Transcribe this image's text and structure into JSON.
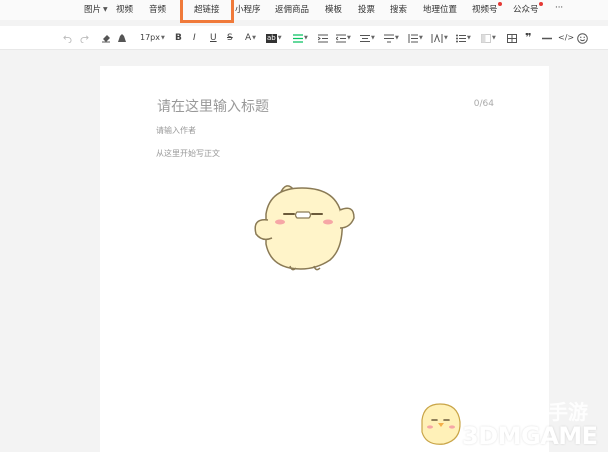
{
  "menu": {
    "items": [
      {
        "label": "图片",
        "dropdown": true
      },
      {
        "label": "视频"
      },
      {
        "label": "音频"
      },
      {
        "label": "超链接"
      },
      {
        "label": "小程序"
      },
      {
        "label": "返佣商品"
      },
      {
        "label": "模板"
      },
      {
        "label": "投票"
      },
      {
        "label": "搜索"
      },
      {
        "label": "地理位置"
      },
      {
        "label": "视频号",
        "red_dot": true
      },
      {
        "label": "公众号",
        "red_dot": true
      },
      {
        "label": "···"
      }
    ],
    "highlighted": "超链接",
    "highlight_color": "#f07a3a"
  },
  "toolbar": {
    "undo_icon": "undo-icon",
    "redo_icon": "redo-icon",
    "font_size": "17px",
    "bold": "B",
    "italic": "I",
    "underline": "U",
    "strike": "S",
    "font_color": "A",
    "bg_color": "ab",
    "accent_color": "#07c160"
  },
  "editor": {
    "title_placeholder": "请在这里输入标题",
    "title_count": "0/64",
    "author_placeholder": "请输入作者",
    "body_placeholder": "从这里开始写正文"
  },
  "watermark": {
    "text": "3DMGAME",
    "cn_text": "手游"
  }
}
